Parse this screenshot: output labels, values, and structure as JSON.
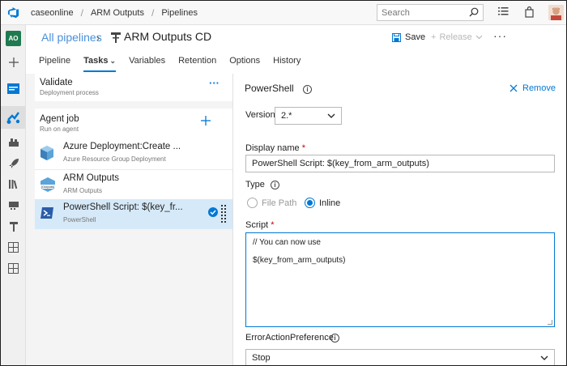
{
  "topbar": {
    "org": "caseonline",
    "project": "ARM Outputs",
    "section": "Pipelines",
    "search_placeholder": "Search"
  },
  "rail": {
    "avatar_initials": "AO"
  },
  "header": {
    "all_pipelines": "All pipelines",
    "title": "ARM Outputs CD",
    "save_label": "Save",
    "release_label": "Release",
    "more": "···"
  },
  "tabs": [
    {
      "label": "Pipeline",
      "active": false
    },
    {
      "label": "Tasks",
      "active": true
    },
    {
      "label": "Variables",
      "active": false
    },
    {
      "label": "Retention",
      "active": false
    },
    {
      "label": "Options",
      "active": false
    },
    {
      "label": "History",
      "active": false
    }
  ],
  "left": {
    "stage": {
      "title": "Validate",
      "subtitle": "Deployment process",
      "more": "···"
    },
    "agent_job": {
      "title": "Agent job",
      "subtitle": "Run on agent"
    },
    "tasks": [
      {
        "name": "Azure Deployment:Create ...",
        "subtitle": "Azure Resource Group Deployment",
        "icon": "azure-cube-icon",
        "selected": false
      },
      {
        "name": "ARM Outputs",
        "subtitle": "ARM Outputs",
        "icon": "arm-outputs-icon",
        "icon_text": "{Outputs}",
        "selected": false
      },
      {
        "name": "PowerShell Script: $(key_fr...",
        "subtitle": "PowerShell",
        "icon": "powershell-icon",
        "selected": true
      }
    ]
  },
  "right": {
    "title": "PowerShell",
    "remove_label": "Remove",
    "version_label": "Version",
    "version_value": "2.*",
    "display_name_label": "Display name",
    "display_name_value": "PowerShell Script: $(key_from_arm_outputs)",
    "type_label": "Type",
    "type_options": [
      "File Path",
      "Inline"
    ],
    "type_selected": "Inline",
    "script_label": "Script",
    "script_lines": [
      "// You can now use",
      "$(key_from_arm_outputs)"
    ],
    "error_pref_label": "ErrorActionPreference",
    "error_pref_value": "Stop",
    "required_mark": "*"
  },
  "colors": {
    "accent": "#0078d4",
    "link": "#4a90d9",
    "selected_row": "#d6e9f8",
    "rail_avatar": "#1f7a50"
  }
}
